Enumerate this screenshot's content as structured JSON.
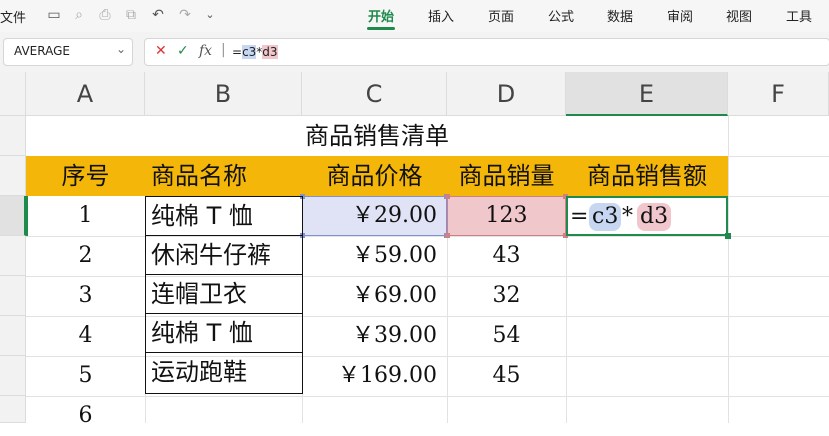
{
  "toolbar": {
    "file_label": "文件",
    "icons": [
      "save-icon",
      "export-icon",
      "print-icon",
      "print-preview-icon",
      "undo-icon",
      "redo-icon",
      "chevron-down-icon"
    ],
    "tabs": [
      {
        "label": "开始",
        "active": true
      },
      {
        "label": "插入",
        "active": false
      },
      {
        "label": "页面",
        "active": false
      },
      {
        "label": "公式",
        "active": false
      },
      {
        "label": "数据",
        "active": false
      },
      {
        "label": "审阅",
        "active": false
      },
      {
        "label": "视图",
        "active": false
      },
      {
        "label": "工具",
        "active": false
      }
    ],
    "accent_color": "#1e8a4c"
  },
  "formula_bar": {
    "name_box": "AVERAGE",
    "cancel_symbol": "✕",
    "confirm_symbol": "✓",
    "fx_symbol": "fx",
    "formula_prefix": "=",
    "ref1": "c3",
    "operator": "*",
    "ref2": "d3"
  },
  "sheet": {
    "columns": [
      "A",
      "B",
      "C",
      "D",
      "E",
      "F"
    ],
    "selected_column": "E",
    "rows": [
      "6"
    ],
    "title": "商品销售清单",
    "header_color": "#f3b609",
    "headers": [
      "序号",
      "商品名称",
      "商品价格",
      "商品销量",
      "商品销售额"
    ],
    "data": [
      {
        "no": "1",
        "name": "纯棉 T 恤",
        "price": "￥29.00",
        "qty": "123"
      },
      {
        "no": "2",
        "name": "休闲牛仔裤",
        "price": "￥59.00",
        "qty": "43"
      },
      {
        "no": "3",
        "name": "连帽卫衣",
        "price": "￥69.00",
        "qty": "32"
      },
      {
        "no": "4",
        "name": "纯棉 T 恤",
        "price": "￥39.00",
        "qty": "54"
      },
      {
        "no": "5",
        "name": "运动跑鞋",
        "price": "￥169.00",
        "qty": "45"
      }
    ],
    "editing": {
      "eq": "=",
      "ref1": "c3",
      "op": "*",
      "ref2": "d3"
    }
  }
}
